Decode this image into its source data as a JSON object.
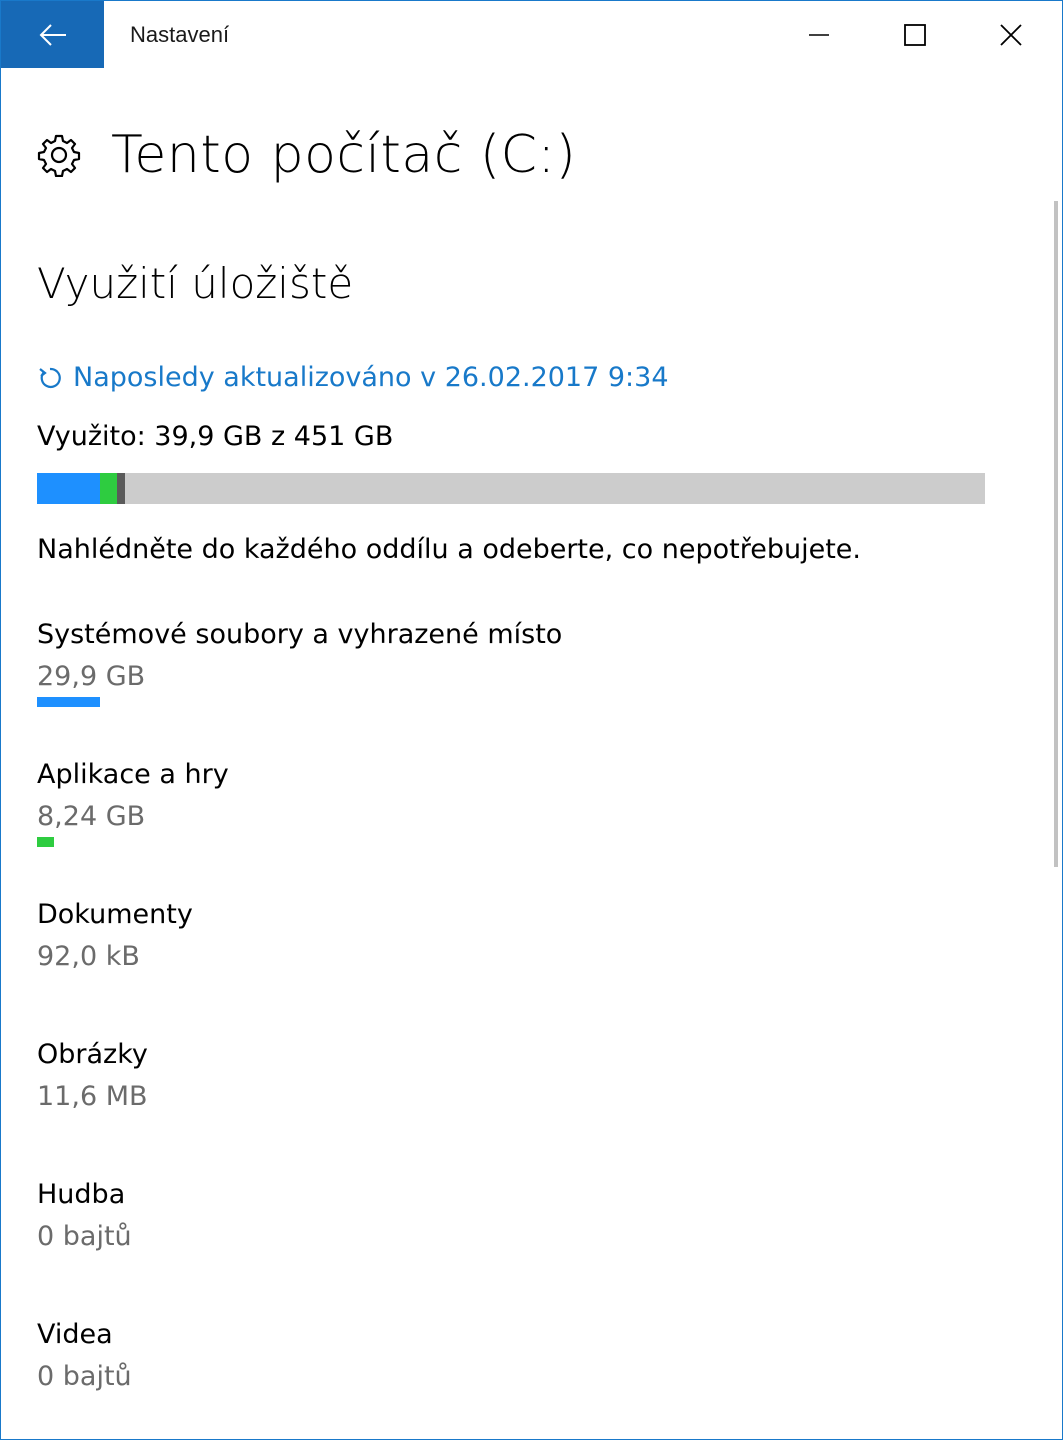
{
  "window": {
    "title": "Nastavení",
    "accent_color": "#1769b6",
    "border_color": "#1979ca"
  },
  "page": {
    "title": "Tento počítač (C:)",
    "header_icon": "gear-icon"
  },
  "storage": {
    "section_title": "Využití úložiště",
    "refresh_icon": "refresh-icon",
    "last_updated": "Naposledy aktualizováno v 26.02.2017 9:34",
    "used_summary": "Využito: 39,9 GB z 451 GB",
    "hint": "Nahlédněte do každého oddílu a odeberte, co nepotřebujete.",
    "usage_fractions": {
      "system": 0.0663,
      "apps": 0.0183,
      "other": 0.0084
    },
    "colors": {
      "system": "#1e90ff",
      "apps": "#2ecc40",
      "other": "#5a5a5a",
      "free": "#cccccc",
      "link": "#1879c9",
      "secondary_text": "#6b6b6b"
    },
    "categories": [
      {
        "name": "Systémové soubory a vyhrazené místo",
        "size": "29,9 GB",
        "color": "#1e90ff",
        "fraction": 0.0663
      },
      {
        "name": "Aplikace a hry",
        "size": "8,24 GB",
        "color": "#2ecc40",
        "fraction": 0.0183
      },
      {
        "name": "Dokumenty",
        "size": "92,0 kB"
      },
      {
        "name": "Obrázky",
        "size": "11,6 MB"
      },
      {
        "name": "Hudba",
        "size": "0 bajtů"
      },
      {
        "name": "Videa",
        "size": "0 bajtů"
      }
    ]
  }
}
